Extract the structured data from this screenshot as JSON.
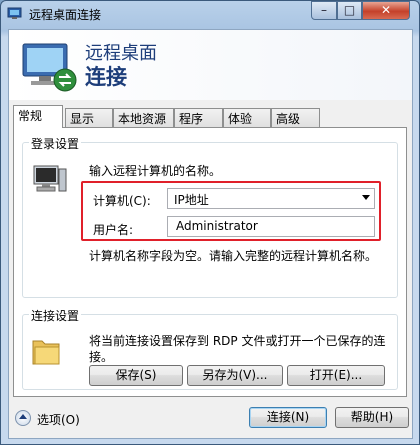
{
  "window": {
    "title": "远程桌面连接",
    "close_glyph": "✕",
    "min_glyph": "–",
    "max_glyph": "□"
  },
  "banner": {
    "line1": "远程桌面",
    "line2": "连接"
  },
  "tabs": [
    {
      "label": "常规",
      "active": true
    },
    {
      "label": "显示"
    },
    {
      "label": "本地资源"
    },
    {
      "label": "程序"
    },
    {
      "label": "体验"
    },
    {
      "label": "高级"
    }
  ],
  "login": {
    "group_label": "登录设置",
    "hint": "输入远程计算机的名称。",
    "computer_label": "计算机(C):",
    "computer_value": "IP地址",
    "username_label": "用户名:",
    "username_value": "Administrator",
    "empty_notice": "计算机名称字段为空。请输入完整的远程计算机名称。"
  },
  "connection": {
    "group_label": "连接设置",
    "description": "将当前连接设置保存到 RDP 文件或打开一个已保存的连接。",
    "save_label": "保存(S)",
    "save_as_label": "另存为(V)...",
    "open_label": "打开(E)..."
  },
  "footer": {
    "options_label": "选项(O)",
    "connect_label": "连接(N)",
    "help_label": "帮助(H)"
  },
  "colors": {
    "highlight_border": "#e0202a",
    "title_accent": "#1d3d7a"
  },
  "icons": [
    "rdp-app-icon",
    "rdp-banner-icon",
    "computer-icon",
    "folder-icon",
    "chevron-up-icon",
    "dropdown-arrow-icon"
  ]
}
